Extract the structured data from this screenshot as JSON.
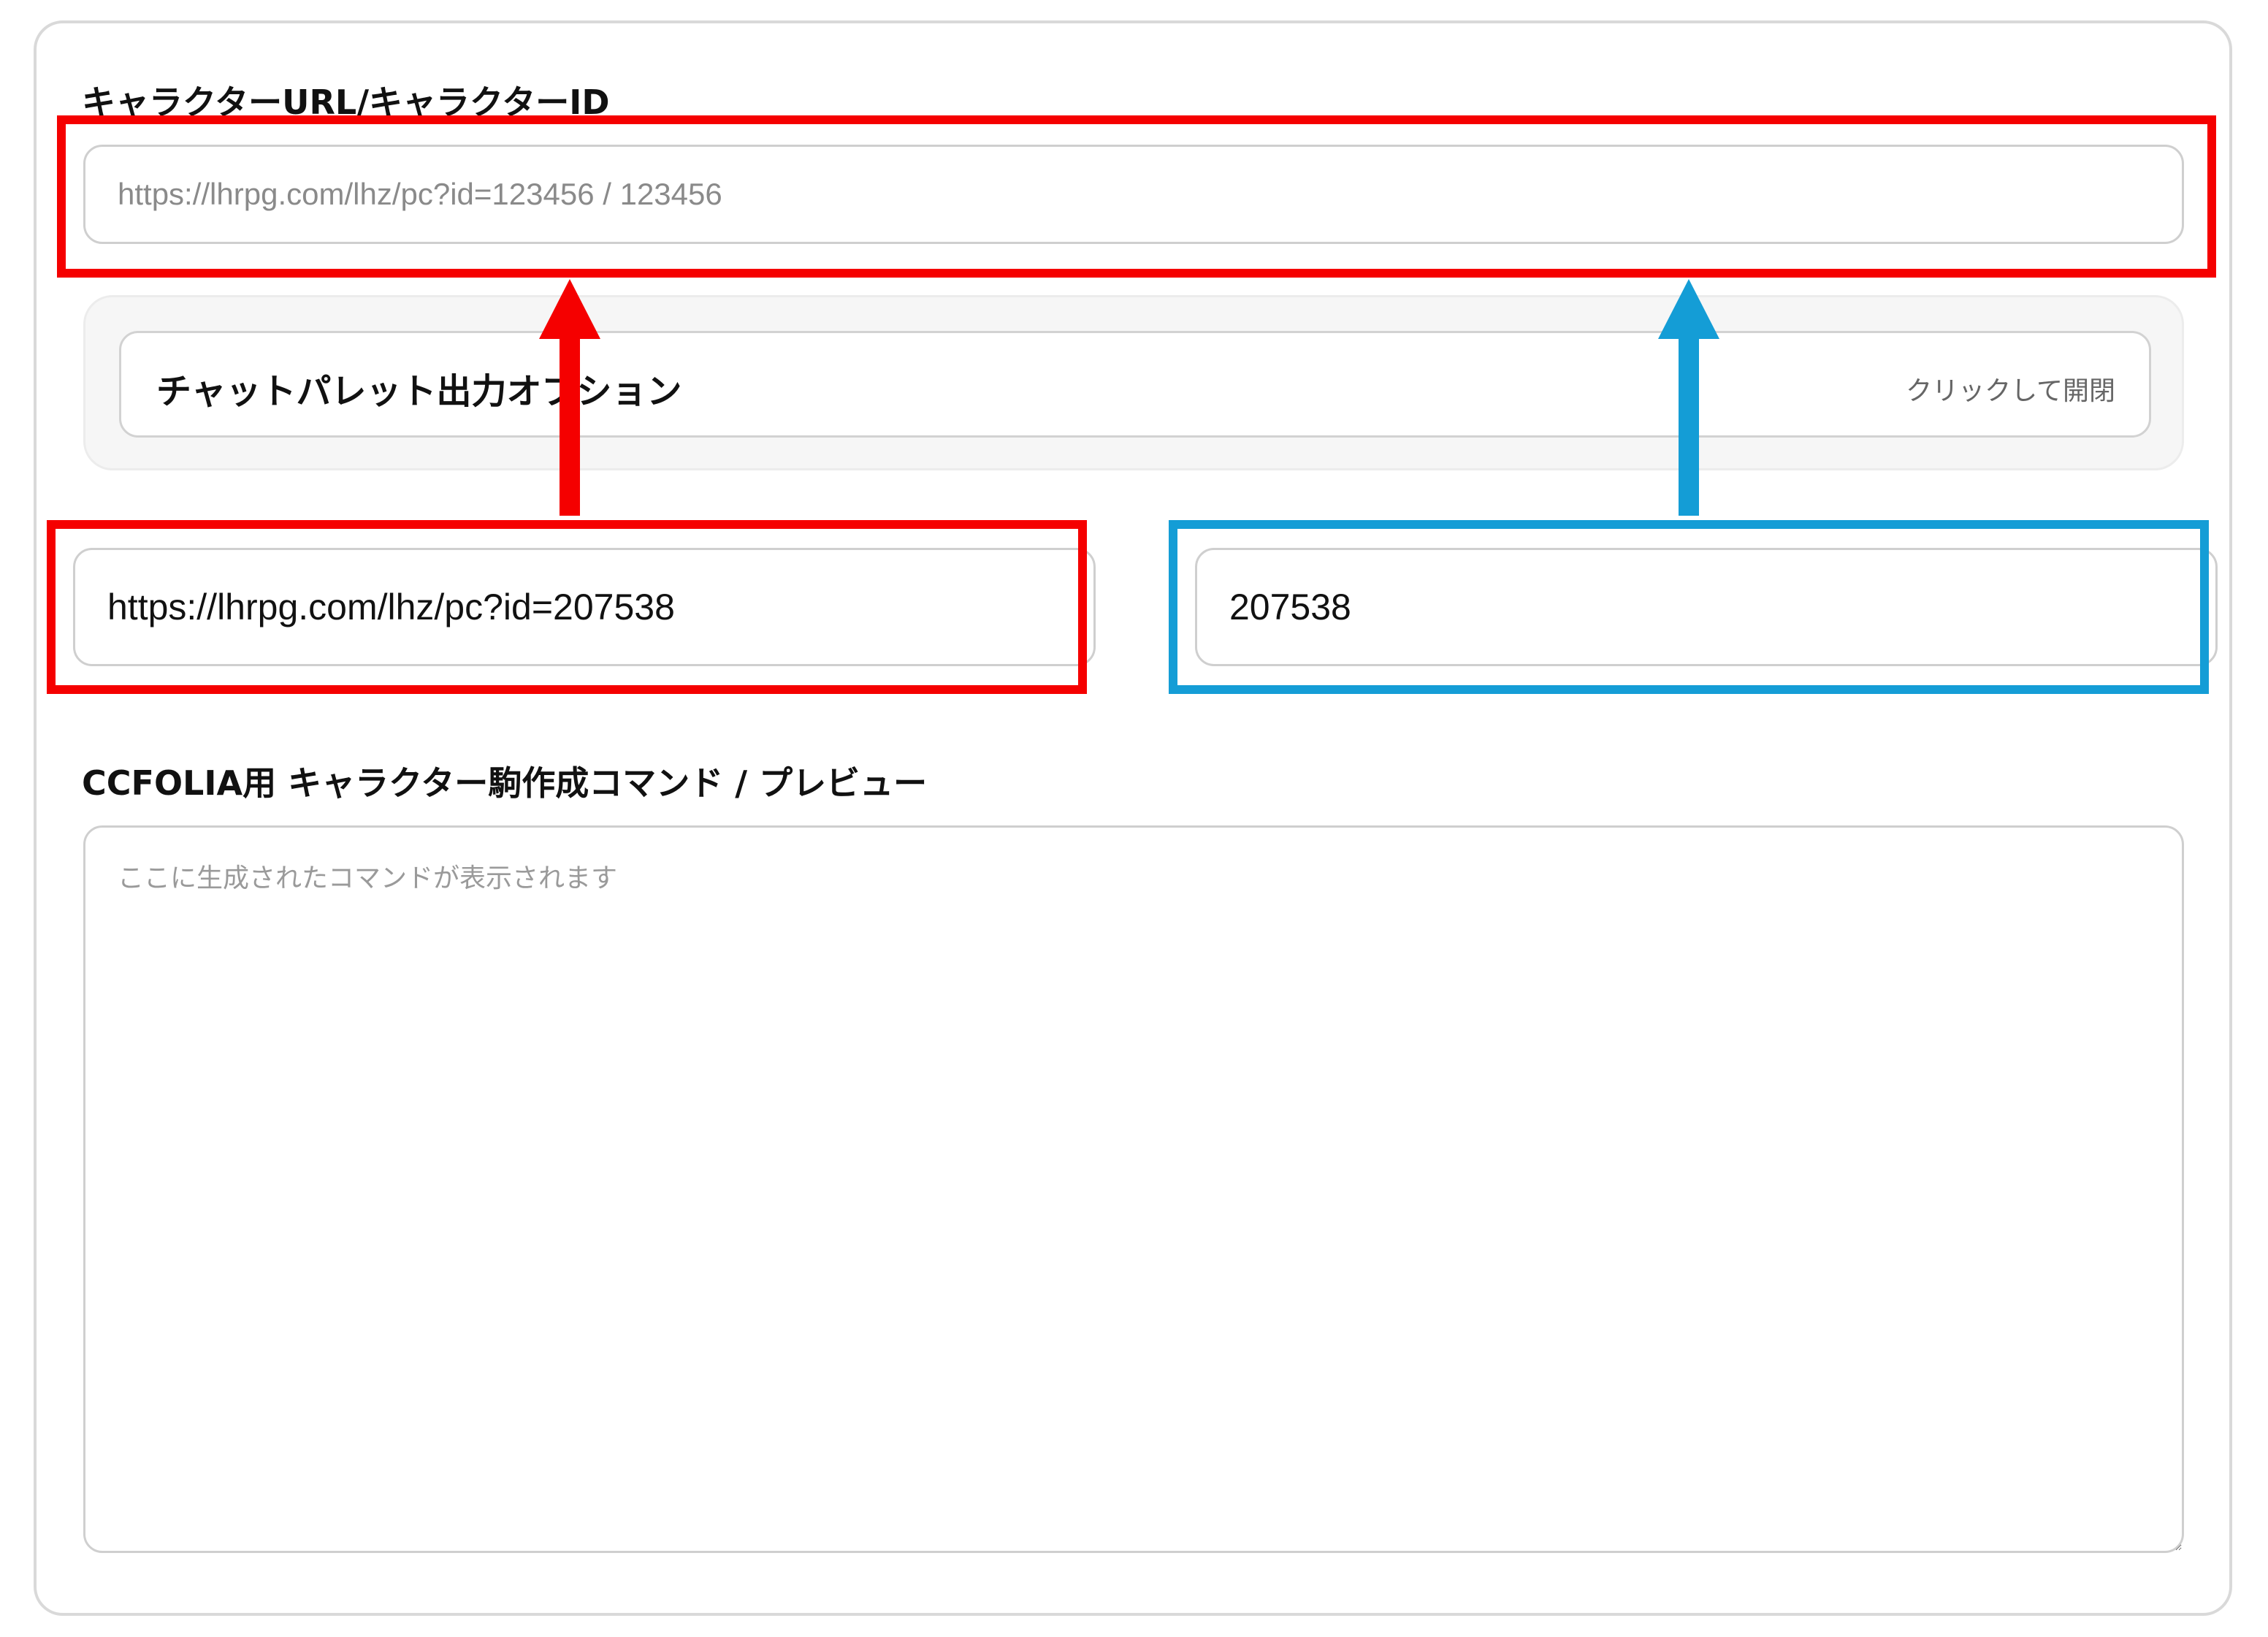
{
  "colors": {
    "highlight_red": "#f50000",
    "highlight_blue": "#149dd6"
  },
  "character": {
    "label": "キャラクターURL/キャラクターID",
    "input_placeholder": "https://lhrpg.com/lhz/pc?id=123456 / 123456",
    "input_value": ""
  },
  "chat_palette": {
    "title": "チャットパレット出力オプション",
    "toggle_hint": "クリックして開閉"
  },
  "examples": {
    "url_value": "https://lhrpg.com/lhz/pc?id=207538",
    "id_value": "207538"
  },
  "command": {
    "label": "CCFOLIA用 キャラクター駒作成コマンド / プレビュー",
    "placeholder": "ここに生成されたコマンドが表示されます",
    "value": ""
  }
}
